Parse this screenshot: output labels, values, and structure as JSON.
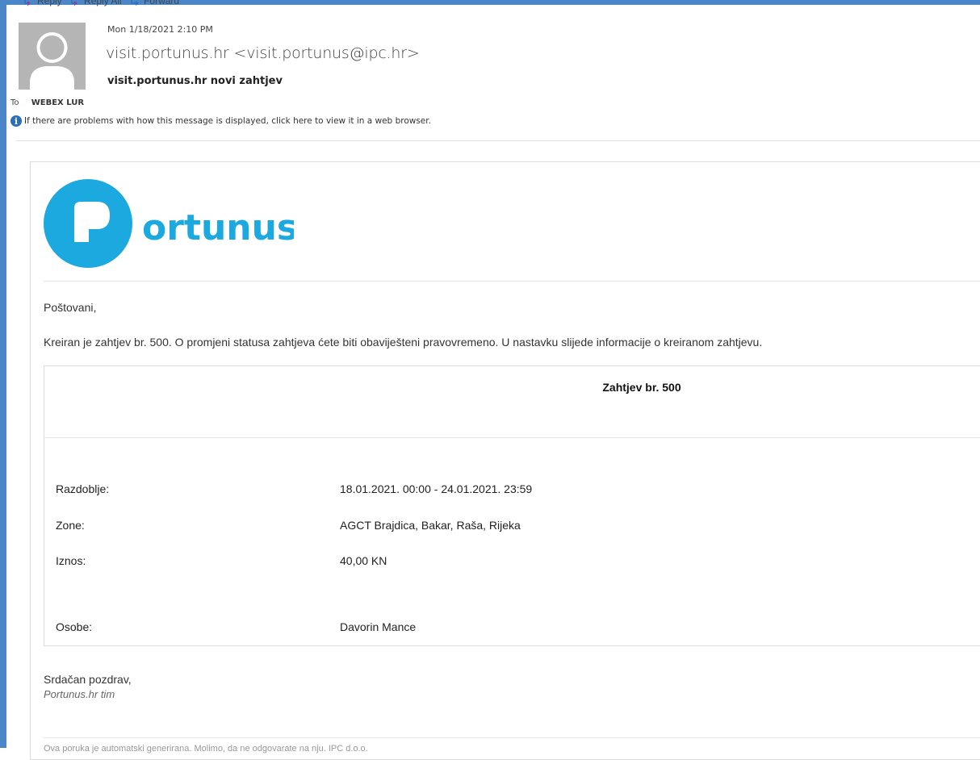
{
  "toolbar": {
    "reply": "Reply",
    "reply_all": "Reply All",
    "forward": "Forward"
  },
  "message": {
    "date": "Mon 1/18/2021 2:10 PM",
    "from": "visit.portunus.hr <visit.portunus@ipc.hr>",
    "subject": "visit.portunus.hr novi zahtjev",
    "to_label": "To",
    "to": "WEBEX LUR",
    "info_text": "If there are problems with how this message is displayed, click here to view it in a web browser."
  },
  "logo": {
    "text": "ortunus",
    "color": "#1ba9df"
  },
  "body": {
    "greeting": "Poštovani,",
    "intro": "Kreiran je zahtjev br. 500. O promjeni statusa zahtjeva ćete biti obaviješteni pravovremeno. U nastavku slijede informacije o kreiranom zahtjevu.",
    "request_title": "Zahtjev br. 500",
    "rows": [
      {
        "label": "Razdoblje:",
        "value": "18.01.2021. 00:00 - 24.01.2021. 23:59"
      },
      {
        "label": "Zone:",
        "value": "AGCT Brajdica, Bakar, Raša, Rijeka"
      },
      {
        "label": "Iznos:",
        "value": "40,00 KN"
      },
      {
        "label": "Osobe:",
        "value": "Davorin Mance"
      }
    ],
    "closing": "Srdačan pozdrav,",
    "signature": "Portunus.hr tim",
    "footer": "Ova poruka je automatski generirana. Molimo, da ne odgovarate na nju. IPC d.o.o."
  },
  "colors": {
    "frame": "#4a86c8",
    "brand": "#1ba9df",
    "info_icon": "#2a6fb9"
  }
}
